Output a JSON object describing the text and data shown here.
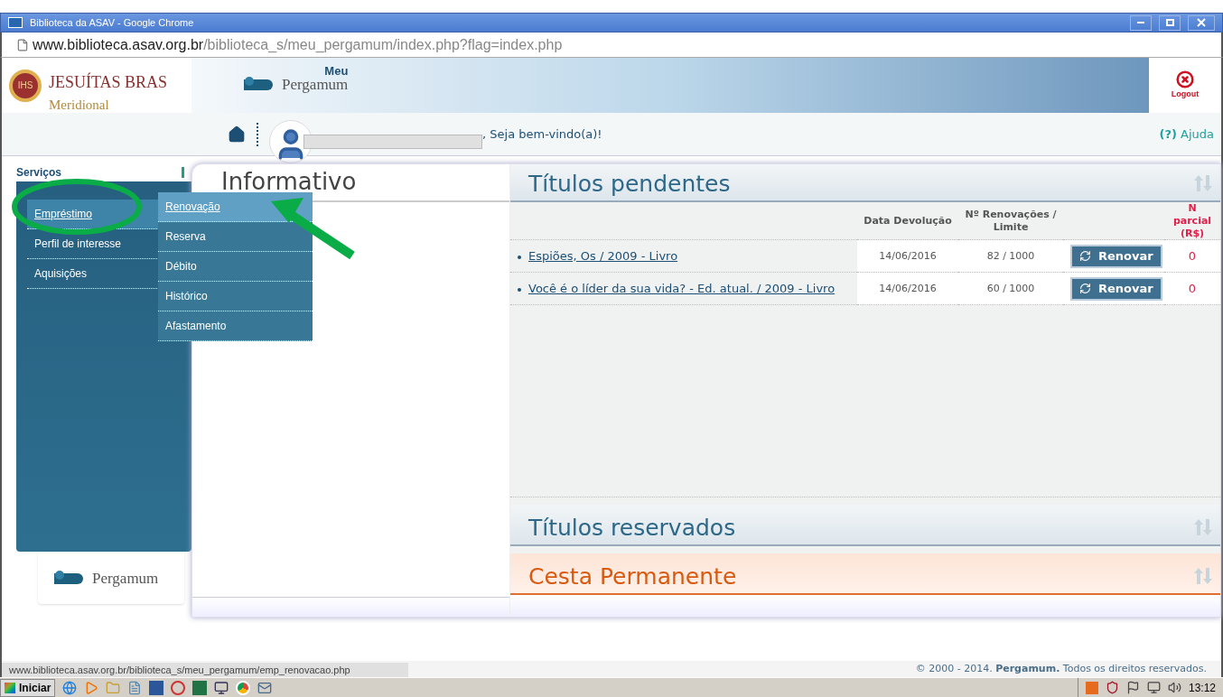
{
  "window": {
    "title": "Biblioteca da ASAV - Google Chrome"
  },
  "address_bar": {
    "domain": "www.biblioteca.asav.org.br",
    "path": "/biblioteca_s/meu_pergamum/index.php?flag=index.php"
  },
  "header": {
    "org_name": "JESUÍTAS BRAS",
    "org_sub": "Meridional",
    "logo_emblem": "IHS",
    "app_top": "Meu",
    "app_name": "Pergamum",
    "logout": "Logout"
  },
  "user_bar": {
    "greeting": ", Seja bem-vindo(a)!",
    "help_mark": "(?)",
    "help": "Ajuda"
  },
  "sidebar": {
    "title": "Serviços",
    "items": [
      {
        "label": "Empréstimo",
        "selected": true
      },
      {
        "label": "Perfil de interesse",
        "selected": false
      },
      {
        "label": "Aquisições",
        "selected": false
      }
    ],
    "submenu": [
      {
        "label": "Renovação",
        "selected": true
      },
      {
        "label": "Reserva",
        "selected": false
      },
      {
        "label": "Débito",
        "selected": false
      },
      {
        "label": "Histórico",
        "selected": false
      },
      {
        "label": "Afastamento",
        "selected": false
      }
    ],
    "footer_logo": "Pergamum"
  },
  "informativo": {
    "title": "Informativo"
  },
  "pending": {
    "title": "Títulos pendentes",
    "columns": [
      "Data Devolução",
      "Nº Renovações / Limite",
      "N parcial (R$)"
    ],
    "rows": [
      {
        "title": "Espiões, Os / 2009 - Livro",
        "date": "14/06/2016",
        "renewals": "82 / 1000",
        "button": "Renovar",
        "amount": "0"
      },
      {
        "title": "Você é o líder da sua vida? - Ed. atual. / 2009 - Livro",
        "date": "14/06/2016",
        "renewals": "60 / 1000",
        "button": "Renovar",
        "amount": "0"
      }
    ]
  },
  "sections": [
    {
      "title": "Títulos reservados",
      "kind": "blue"
    },
    {
      "title": "Cesta Permanente",
      "kind": "orange"
    }
  ],
  "copyright": "© 2000 - 2014. **Pergamum.** Todos os direitos reservados.",
  "status_url": "www.biblioteca.asav.org.br/biblioteca_s/meu_pergamum/emp_renovacao.php",
  "taskbar": {
    "start": "Iniciar",
    "clock": "13:12"
  }
}
